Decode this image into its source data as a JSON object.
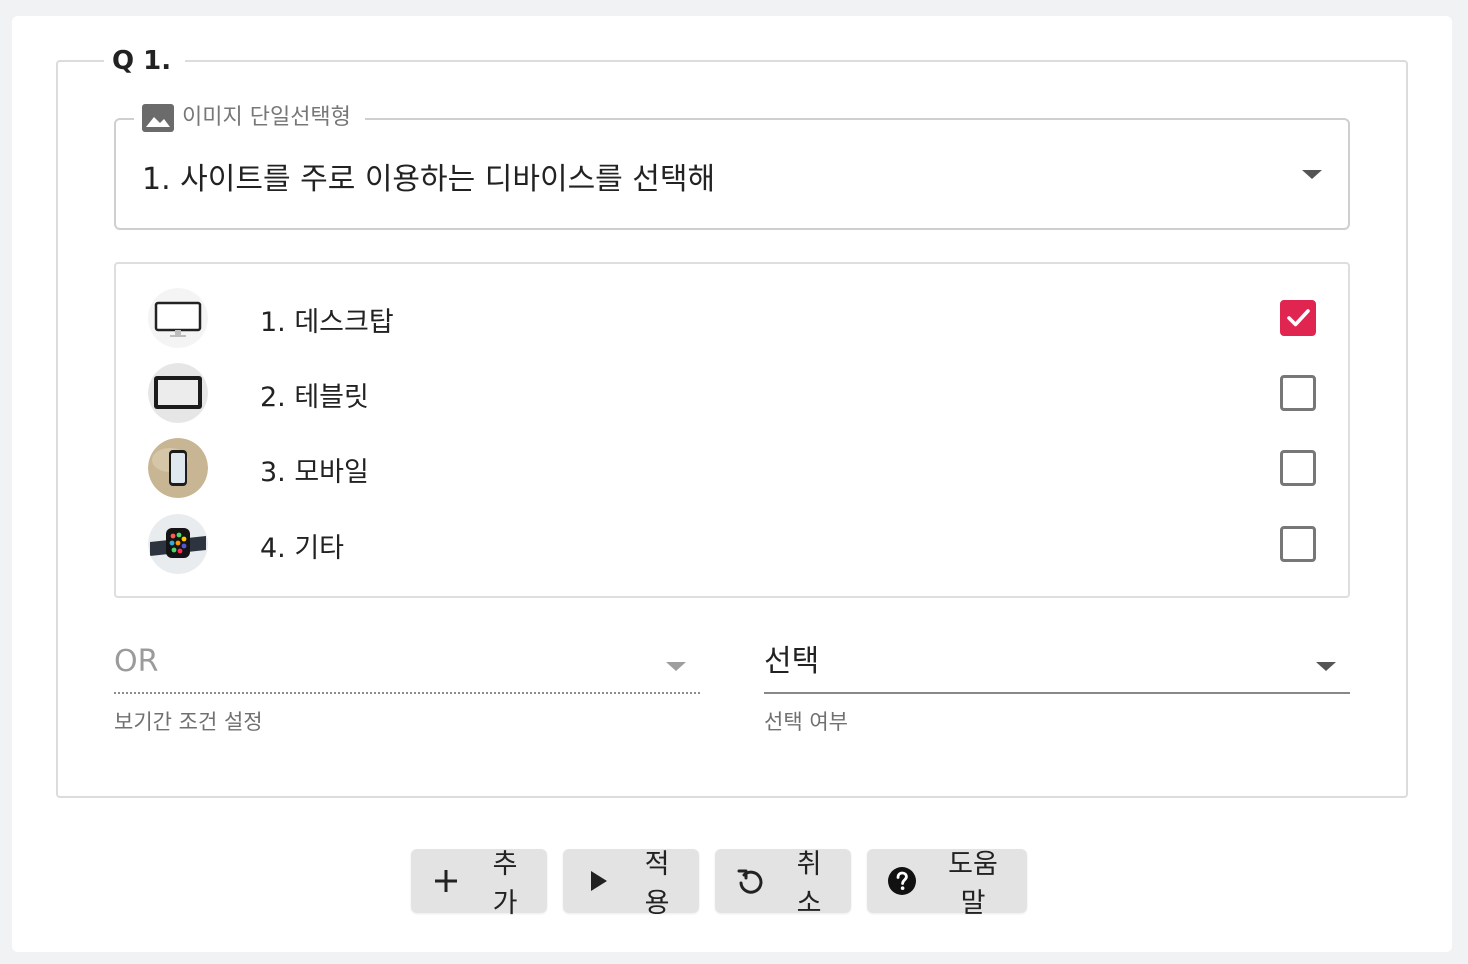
{
  "question": {
    "number_label": "Q 1.",
    "type_select": {
      "legend": "이미지 단일선택형",
      "value": "1. 사이트를 주로 이용하는 디바이스를 선택해"
    },
    "options": [
      {
        "label": "1. 데스크탑",
        "icon": "desktop-thumbnail",
        "checked": true
      },
      {
        "label": "2. 테블릿",
        "icon": "tablet-thumbnail",
        "checked": false
      },
      {
        "label": "3. 모바일",
        "icon": "mobile-thumbnail",
        "checked": false
      },
      {
        "label": "4. 기타",
        "icon": "smartwatch-thumbnail",
        "checked": false
      }
    ],
    "condition_field": {
      "value": "OR",
      "helper": "보기간 조건 설정"
    },
    "selection_field": {
      "value": "선택",
      "helper": "선택 여부"
    }
  },
  "buttons": {
    "add": "추가",
    "apply": "적용",
    "cancel": "취소",
    "help": "도움말"
  },
  "colors": {
    "accent": "#e02551",
    "button_bg": "#e3e3e3",
    "page_bg": "#f1f2f4"
  }
}
